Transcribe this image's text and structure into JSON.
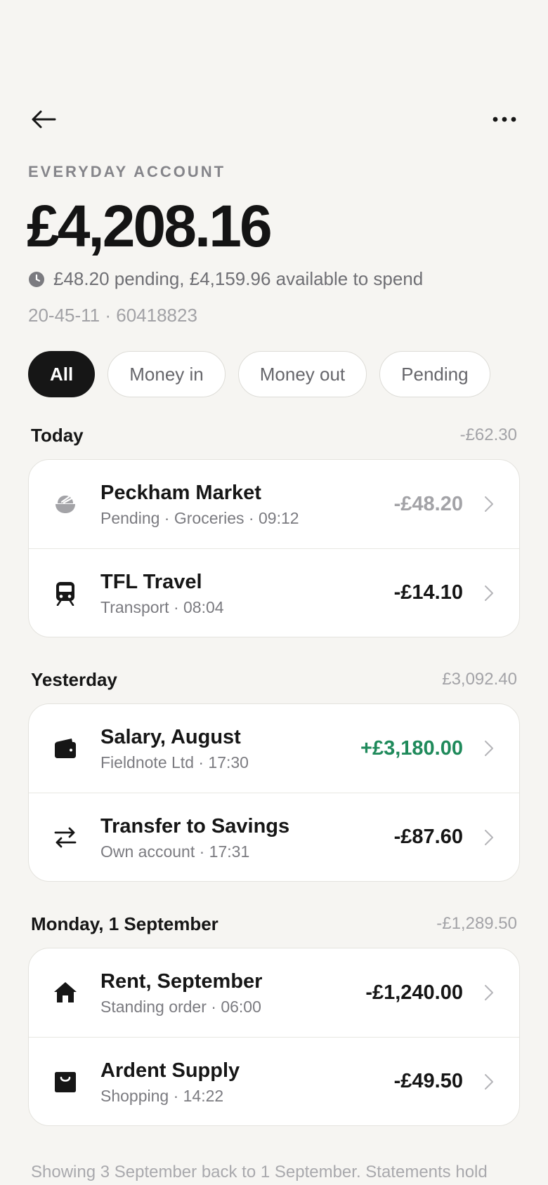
{
  "header": {
    "account_label": "EVERYDAY ACCOUNT",
    "balance": "£4,208.16",
    "pending_text": "£48.20 pending, £4,159.96 available to spend",
    "sort_code_account": "20-45-11 · 60418823"
  },
  "filters": [
    {
      "label": "All",
      "active": true
    },
    {
      "label": "Money in",
      "active": false
    },
    {
      "label": "Money out",
      "active": false
    },
    {
      "label": "Pending",
      "active": false
    }
  ],
  "sections": [
    {
      "title": "Today",
      "total": "-£62.30",
      "transactions": [
        {
          "title": "Peckham Market",
          "subtitle": "Pending · Groceries · 09:12",
          "amount": "-£48.20",
          "status": "pending",
          "icon": "groceries-bowl-icon"
        },
        {
          "title": "TFL Travel",
          "subtitle": "Transport · 08:04",
          "amount": "-£14.10",
          "status": "debit",
          "icon": "train-icon"
        }
      ]
    },
    {
      "title": "Yesterday",
      "total": "£3,092.40",
      "transactions": [
        {
          "title": "Salary, August",
          "subtitle": "Fieldnote Ltd · 17:30",
          "amount": "+£3,180.00",
          "status": "credit",
          "icon": "wallet-icon"
        },
        {
          "title": "Transfer to Savings",
          "subtitle": "Own account · 17:31",
          "amount": "-£87.60",
          "status": "debit",
          "icon": "transfer-arrows-icon"
        }
      ]
    },
    {
      "title": "Monday, 1 September",
      "total": "-£1,289.50",
      "transactions": [
        {
          "title": "Rent, September",
          "subtitle": "Standing order · 06:00",
          "amount": "-£1,240.00",
          "status": "debit",
          "icon": "home-icon"
        },
        {
          "title": "Ardent Supply",
          "subtitle": "Shopping · 14:22",
          "amount": "-£49.50",
          "status": "debit",
          "icon": "shopping-bag-icon"
        }
      ]
    }
  ],
  "footnote": "Showing 3 September back to 1 September. Statements hold",
  "colors": {
    "credit": "#1f8a5b",
    "background": "#f6f5f2",
    "text": "#161616"
  }
}
